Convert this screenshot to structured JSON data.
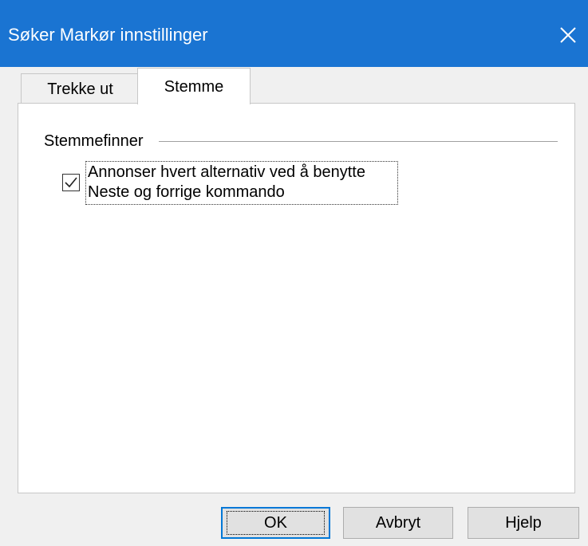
{
  "window": {
    "title": "Søker Markør innstillinger"
  },
  "tabs": [
    {
      "label": "Trekke ut",
      "active": false
    },
    {
      "label": "Stemme",
      "active": true
    }
  ],
  "group": {
    "label": "Stemmefinner"
  },
  "checkbox": {
    "checked": true,
    "label_line1": "Annonser hvert alternativ ved å benytte",
    "label_line2": "Neste og forrige kommando"
  },
  "buttons": {
    "ok": "OK",
    "cancel": "Avbryt",
    "help": "Hjelp"
  },
  "colors": {
    "titlebar": "#1a74d2",
    "ok_border": "#0078d7"
  }
}
